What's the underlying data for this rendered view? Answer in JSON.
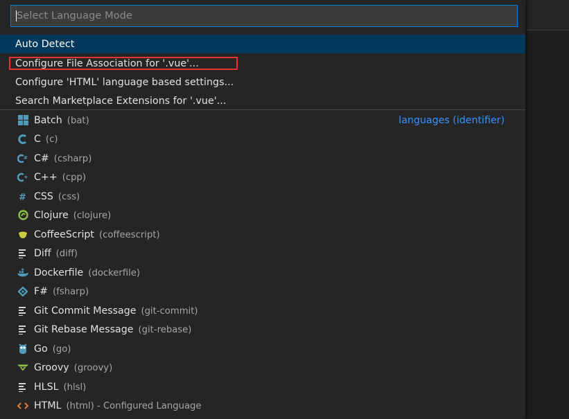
{
  "input": {
    "placeholder": "Select Language Mode"
  },
  "actions": [
    {
      "label": "Auto Detect",
      "selected": true
    },
    {
      "label": "Configure File Association for '.vue'...",
      "highlighted": true
    },
    {
      "label": "Configure 'HTML' language based settings..."
    },
    {
      "label": "Search Marketplace Extensions for '.vue'..."
    }
  ],
  "group_label": "languages (identifier)",
  "languages": [
    {
      "name": "Batch",
      "id": "(bat)",
      "icon": "windows-icon"
    },
    {
      "name": "C",
      "id": "(c)",
      "icon": "c-icon"
    },
    {
      "name": "C#",
      "id": "(csharp)",
      "icon": "csharp-icon"
    },
    {
      "name": "C++",
      "id": "(cpp)",
      "icon": "cpp-icon"
    },
    {
      "name": "CSS",
      "id": "(css)",
      "icon": "hash-icon"
    },
    {
      "name": "Clojure",
      "id": "(clojure)",
      "icon": "clojure-icon"
    },
    {
      "name": "CoffeeScript",
      "id": "(coffeescript)",
      "icon": "coffee-icon"
    },
    {
      "name": "Diff",
      "id": "(diff)",
      "icon": "lines-icon"
    },
    {
      "name": "Dockerfile",
      "id": "(dockerfile)",
      "icon": "docker-icon"
    },
    {
      "name": "F#",
      "id": "(fsharp)",
      "icon": "fsharp-icon"
    },
    {
      "name": "Git Commit Message",
      "id": "(git-commit)",
      "icon": "lines-icon"
    },
    {
      "name": "Git Rebase Message",
      "id": "(git-rebase)",
      "icon": "lines-icon"
    },
    {
      "name": "Go",
      "id": "(go)",
      "icon": "go-icon"
    },
    {
      "name": "Groovy",
      "id": "(groovy)",
      "icon": "groovy-icon"
    },
    {
      "name": "HLSL",
      "id": "(hlsl)",
      "icon": "lines-icon"
    },
    {
      "name": "HTML",
      "id": "(html)",
      "extra": " - Configured Language",
      "icon": "html-icon"
    }
  ],
  "colors": {
    "accent_blue": "#3794ff",
    "selection": "#04395e",
    "highlight_border": "#e23434",
    "icon_blue": "#519aba",
    "icon_green": "#8dc149",
    "icon_yellow": "#cbcb41",
    "icon_orange": "#e37933"
  }
}
